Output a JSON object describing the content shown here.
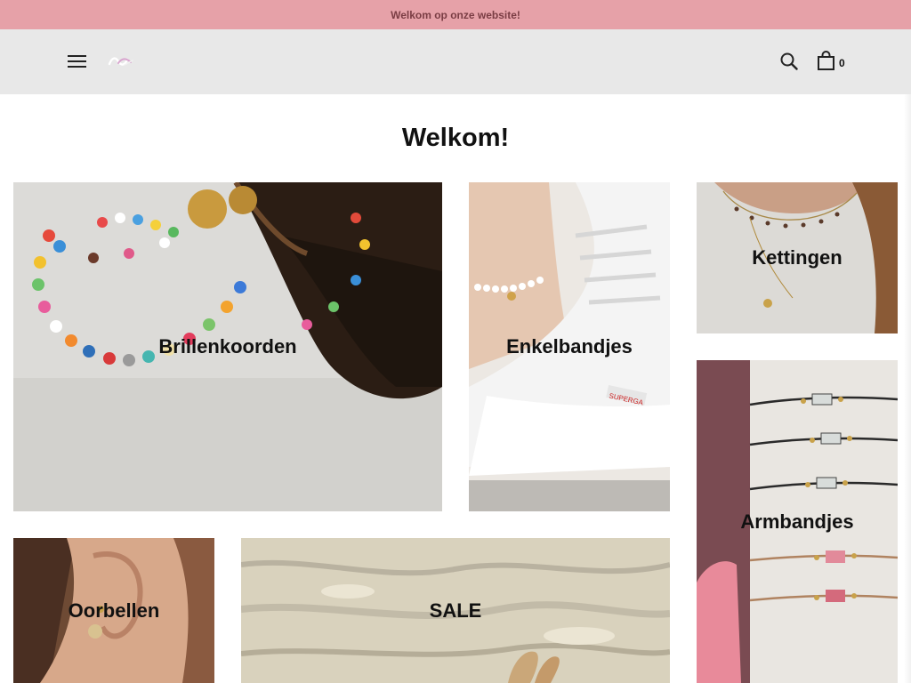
{
  "announcement": {
    "text": "Welkom op onze website!"
  },
  "header": {
    "menu_icon": "hamburger-menu-icon",
    "logo_icon": "brand-logo-icon",
    "search_icon": "search-icon",
    "cart_icon": "shopping-bag-icon",
    "cart_count": "0"
  },
  "main": {
    "title": "Welkom!",
    "collections": [
      {
        "label": "Brillenkoorden"
      },
      {
        "label": "Enkelbandjes"
      },
      {
        "label": "Kettingen"
      },
      {
        "label": "Armbandjes"
      },
      {
        "label": "Oorbellen"
      },
      {
        "label": "SALE"
      }
    ]
  },
  "colors": {
    "announcement_bg": "#e6a1a8",
    "header_bg": "#e8e8e8",
    "text": "#111111"
  }
}
